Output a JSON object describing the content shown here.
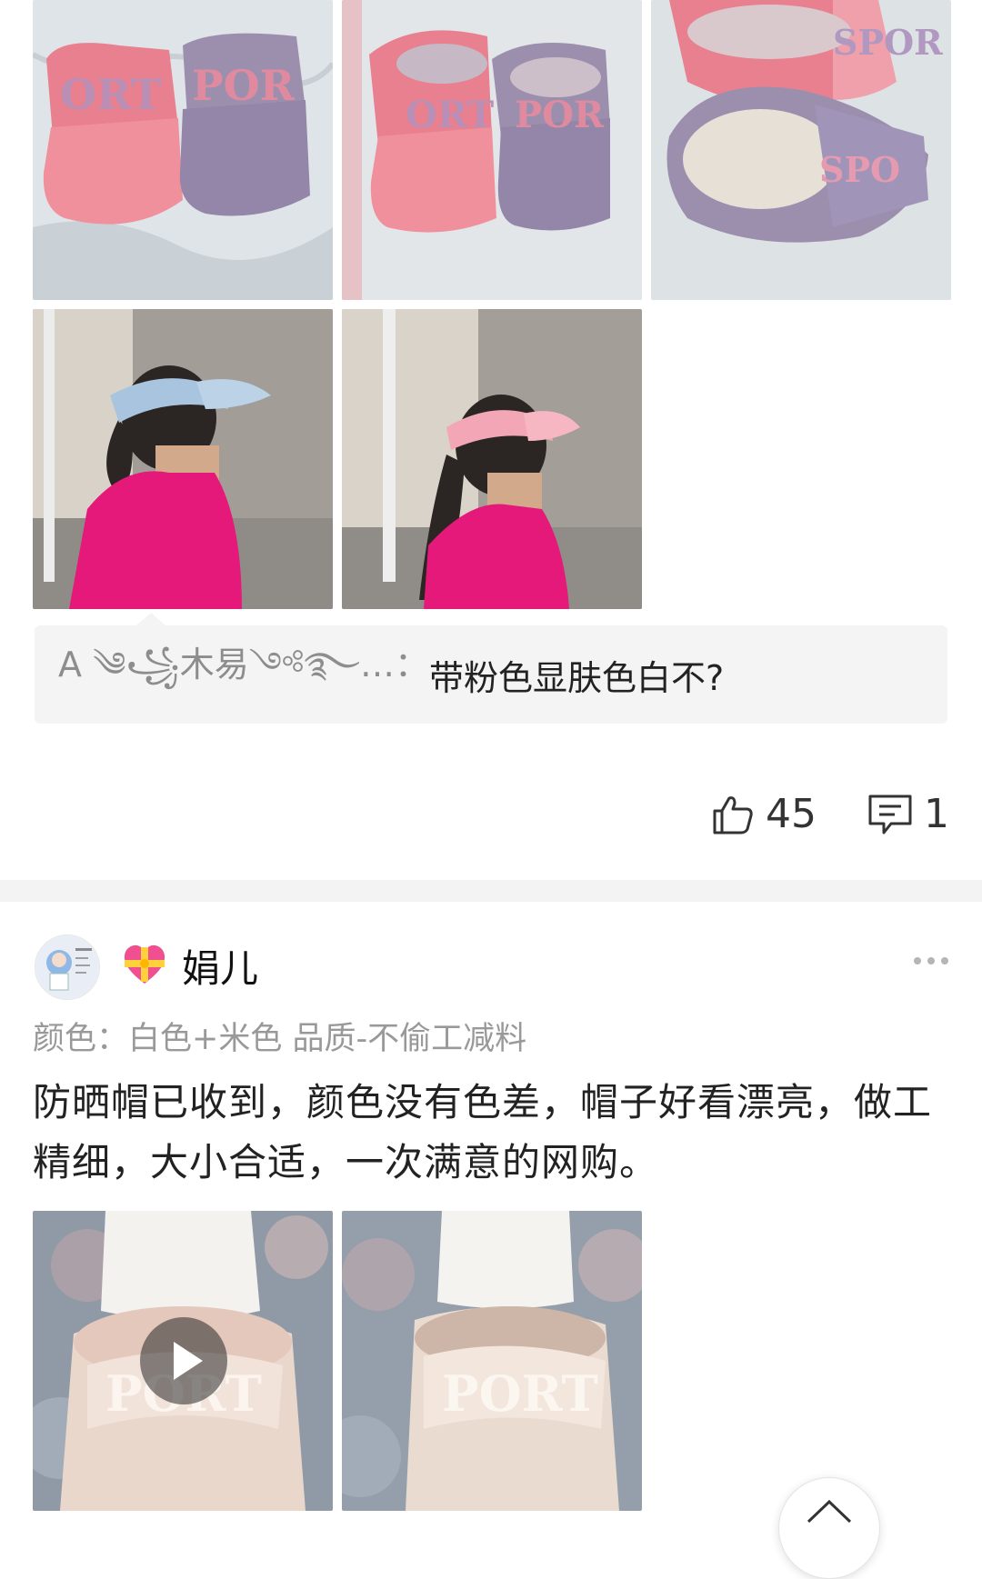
{
  "review1": {
    "photos": [
      {
        "alt": "pink-and-purple-sport-visors"
      },
      {
        "alt": "sport-visors-angle"
      },
      {
        "alt": "visors-inside-view"
      },
      {
        "alt": "girl-wearing-blue-visor"
      },
      {
        "alt": "girl-wearing-pink-visor"
      }
    ],
    "reply": {
      "name": "A ༄꧁木易༺࿐…：",
      "text": "带粉色显肤色白不?"
    },
    "likes": "45",
    "comments": "1"
  },
  "review2": {
    "username": "娟儿",
    "spec": "颜色：白色+米色  品质-不偷工减料",
    "content": "防晒帽已收到，颜色没有色差，帽子好看漂亮，做工精细，大小合适，一次满意的网购。",
    "media": [
      {
        "type": "video",
        "alt": "beige-visor-video"
      },
      {
        "type": "photo",
        "alt": "beige-visor-photo"
      }
    ]
  },
  "icons": {
    "like": "thumbs-up-icon",
    "comment": "comment-icon",
    "more": "more-icon",
    "heart": "heart-badge-icon",
    "play": "play-icon",
    "top": "back-to-top-icon"
  },
  "colors": {
    "background": "#ffffff",
    "divider": "#f3f3f3",
    "reply_bg": "#f4f4f4",
    "muted_text": "#999999"
  }
}
